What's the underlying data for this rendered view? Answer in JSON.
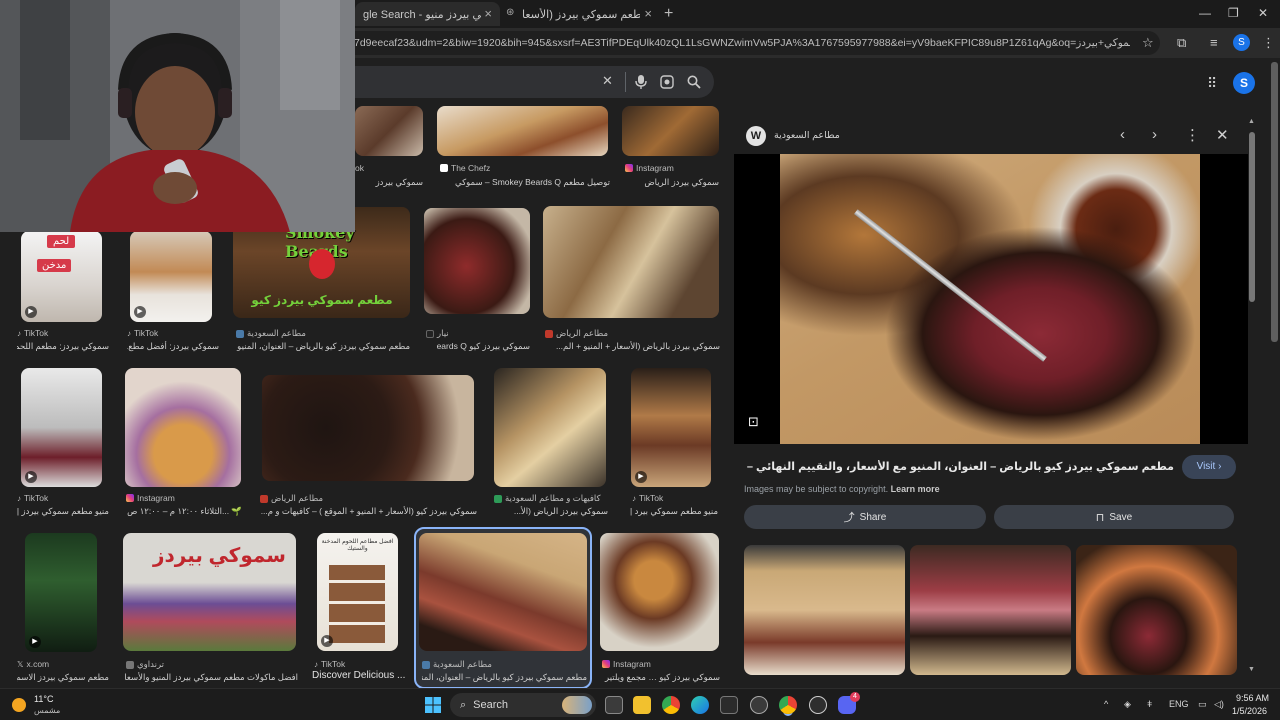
{
  "browser": {
    "tabs": [
      {
        "label": "gle Search - سموكي بيردز منيو"
      },
      {
        "label": "منيو مطعم سموكي بيردز (الأسعا"
      }
    ],
    "url": "7d9eecaf23&udm=2&biw=1920&bih=945&sxsrf=AE3TifPDEqUlk40zQL1LsGWNZwimVw5PJA%3A1767595977988&ei=yV9baeKFPIC89u8P1Z61qAg&oq=سموكي+بيردز&gs_lp=Egtnd3Mtd2l...",
    "profile_initial": "S"
  },
  "header": {
    "avatar_initial": "S"
  },
  "grid": {
    "row1": [
      {
        "source": "ok",
        "caption": "سموكي بيردز"
      },
      {
        "source": "The Chefz",
        "caption": "توصيل مطعم Smokey Beards Q – سموكي"
      },
      {
        "source": "Instagram",
        "caption": "سموكي بيردز الرياض"
      }
    ],
    "row2": [
      {
        "source": "TikTok",
        "caption": "سموكي بيردز: مطعم اللحم"
      },
      {
        "source": "TikTok",
        "caption": "سموكي بيردز: أفضل مطع..."
      },
      {
        "source": "مطاعم السعودية",
        "caption": "مطعم سموكي بيردز كيو بالرياض – العنوان، المنيو مع"
      },
      {
        "source": "نيار",
        "caption": "سموكي بيردز كيو eards Q"
      },
      {
        "source": "مطاعم الرياض",
        "caption": "سموكي بيردز بالرياض (الأسعار + المنيو + الم..."
      }
    ],
    "row3": [
      {
        "source": "TikTok",
        "caption": "منيو مطعم سموكي بيردز |"
      },
      {
        "source": "Instagram",
        "caption": "🌱 ...الثلاثاء ١٢:٠٠ م – ١٢:٠٠ ص"
      },
      {
        "source": "مطاعم الرياض",
        "caption": "سموكي بيردز كيو (الأسعار + المنيو + الموقع ) – كافيهات و م..."
      },
      {
        "source": "كافيهات و مطاعم السعودية",
        "caption": "سموكي بيردز الرياض (الأ..."
      },
      {
        "source": "TikTok",
        "caption": "منيو مطعم سموكي بيرد |"
      }
    ],
    "row4": [
      {
        "source": "x.com",
        "caption": "مطعم سموكي بيردز الاسم"
      },
      {
        "source": "ترنداوي",
        "caption": "افضل ماكولات مطعم سموكي بيردز المنيو والأسعار"
      },
      {
        "source": "TikTok",
        "caption": "Discover Delicious ..."
      },
      {
        "source": "مطاعم السعودية",
        "caption": "مطعم سموكي بيردز كيو بالرياض – العنوان، المنيو"
      },
      {
        "source": "Instagram",
        "caption": "سموكي بيردز كيو … مجمع ويلتير"
      }
    ],
    "overlay_texts": {
      "lahm": "لحم",
      "mudakhan": "مدخن",
      "logo": "Smokey Beards",
      "sign": "مطعم سموكي بيردز كيو",
      "storefront": "سموكي بيردز",
      "menu_title": "افضل مطاعم اللحوم المدخنة والستيك"
    }
  },
  "panel": {
    "source_name": "مطاعم السعودية",
    "title": "مطعم سموكي بيردز كيو بالرياض – العنوان، المنيو مع الأسعار، والتقييم النهائي – مطاعم السعودية",
    "visit_label": "Visit",
    "copyright_text": "Images may be subject to copyright.",
    "learn_more": "Learn more",
    "share_label": "Share",
    "save_label": "Save"
  },
  "taskbar": {
    "temperature": "11°C",
    "weather_desc": "مشمس",
    "search_label": "Search",
    "language": "ENG",
    "time": "9:56 AM",
    "date": "1/5/2026",
    "discord_badge": "4"
  },
  "colors": {
    "accent": "#8ab4f8",
    "visit_bg": "#394457",
    "page_bg": "#1f1f1f"
  }
}
